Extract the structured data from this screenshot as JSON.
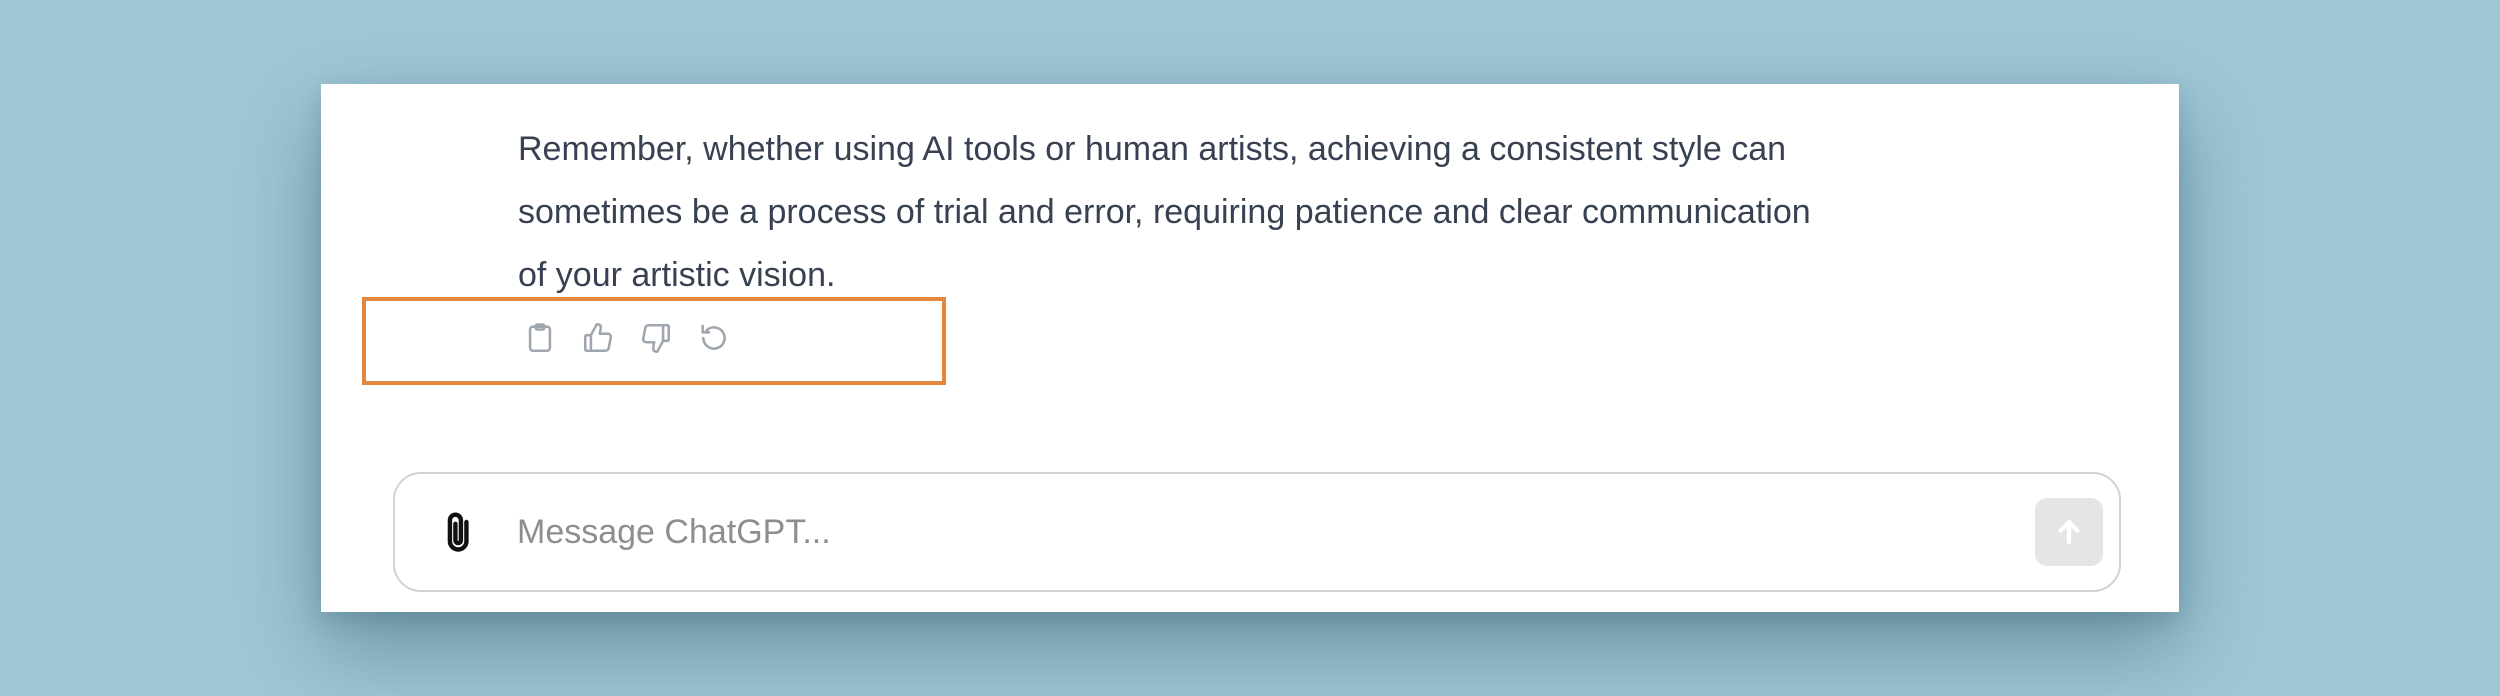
{
  "message": {
    "lines": [
      "Remember, whether using AI tools or human artists, achieving a consistent style can",
      "sometimes be a process of trial and error, requiring patience and clear communication",
      "of your artistic vision."
    ]
  },
  "actions": {
    "icons": [
      "clipboard-icon",
      "thumbs-up-icon",
      "thumbs-down-icon",
      "regenerate-icon"
    ],
    "highlight_color": "#e3873f"
  },
  "composer": {
    "placeholder": "Message ChatGPT...",
    "value": "",
    "attach_icon": "paperclip-icon",
    "send_icon": "arrow-up-icon"
  },
  "colors": {
    "background": "#9fc7d6",
    "panel": "#ffffff",
    "text": "#374151",
    "send_disabled": "#e5e5e5"
  }
}
